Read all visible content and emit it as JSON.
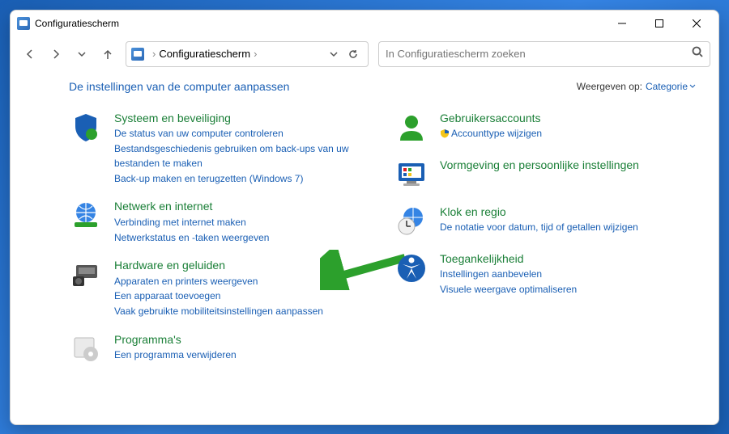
{
  "window": {
    "title": "Configuratiescherm"
  },
  "nav": {
    "breadcrumb": "Configuratiescherm",
    "search_placeholder": "In Configuratiescherm zoeken"
  },
  "header": {
    "title": "De instellingen van de computer aanpassen",
    "view_label": "Weergeven op:",
    "view_mode": "Categorie"
  },
  "left": [
    {
      "title": "Systeem en beveiliging",
      "links": [
        "De status van uw computer controleren",
        "Bestandsgeschiedenis gebruiken om back-ups van uw bestanden te maken",
        "Back-up maken en terugzetten (Windows 7)"
      ]
    },
    {
      "title": "Netwerk en internet",
      "links": [
        "Verbinding met internet maken",
        "Netwerkstatus en -taken weergeven"
      ]
    },
    {
      "title": "Hardware en geluiden",
      "links": [
        "Apparaten en printers weergeven",
        "Een apparaat toevoegen",
        "Vaak gebruikte mobiliteitsinstellingen aanpassen"
      ]
    },
    {
      "title": "Programma's",
      "links": [
        "Een programma verwijderen"
      ]
    }
  ],
  "right": [
    {
      "title": "Gebruikersaccounts",
      "links": [
        "Accounttype wijzigen"
      ],
      "shielded": [
        true
      ]
    },
    {
      "title": "Vormgeving en persoonlijke instellingen",
      "links": []
    },
    {
      "title": "Klok en regio",
      "links": [
        "De notatie voor datum, tijd of getallen wijzigen"
      ]
    },
    {
      "title": "Toegankelijkheid",
      "links": [
        "Instellingen aanbevelen",
        "Visuele weergave optimaliseren"
      ]
    }
  ]
}
